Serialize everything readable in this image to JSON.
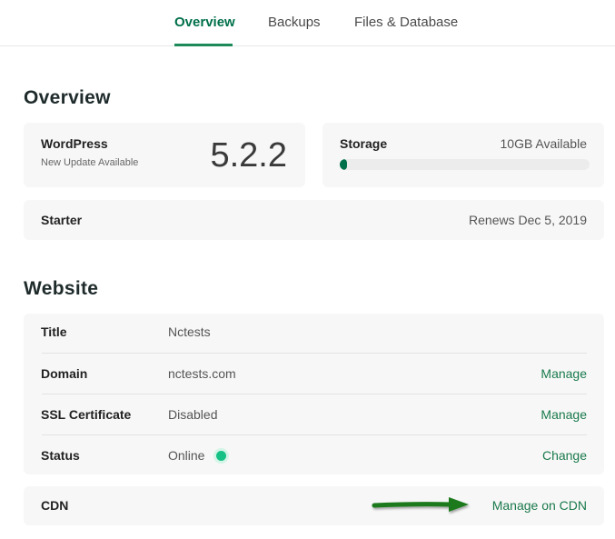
{
  "tabs": [
    {
      "label": "Overview",
      "active": true
    },
    {
      "label": "Backups",
      "active": false
    },
    {
      "label": "Files & Database",
      "active": false
    }
  ],
  "overview": {
    "heading": "Overview",
    "wordpress": {
      "label": "WordPress",
      "sub": "New Update Available",
      "version": "5.2.2"
    },
    "storage": {
      "label": "Storage",
      "available": "10GB Available",
      "used_fraction": 0.02
    },
    "plan": {
      "name": "Starter",
      "renews": "Renews Dec 5, 2019"
    }
  },
  "website": {
    "heading": "Website",
    "rows": [
      {
        "label": "Title",
        "value": "Nctests",
        "action": ""
      },
      {
        "label": "Domain",
        "value": "nctests.com",
        "action": "Manage"
      },
      {
        "label": "SSL Certificate",
        "value": "Disabled",
        "action": "Manage"
      },
      {
        "label": "Status",
        "value": "Online",
        "action": "Change"
      }
    ],
    "cdn": {
      "label": "CDN",
      "action": "Manage on CDN"
    }
  },
  "colors": {
    "accent": "#1a7a4c",
    "status_online": "#17c186",
    "annotation_arrow": "#1a7a1a"
  },
  "icons": {
    "status": "status-dot-icon",
    "annotation": "arrow-right-icon"
  }
}
